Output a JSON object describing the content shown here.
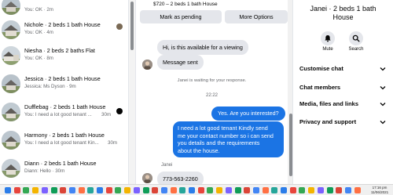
{
  "conversations": [
    {
      "name": "",
      "preview": "You: OK · 2m",
      "meta": "",
      "indicator": "none"
    },
    {
      "name": "Nichole · 2 beds 1 bath House",
      "preview": "You: OK · 4m",
      "meta": "",
      "indicator": "avatar"
    },
    {
      "name": "Niesha · 2 beds 2 baths Flat",
      "preview": "You: OK · 8m",
      "meta": "",
      "indicator": "none"
    },
    {
      "name": "Jessica · 2 beds 1 bath House",
      "preview": "Jessica: Ms Dyson · 9m",
      "meta": "",
      "indicator": "none"
    },
    {
      "name": "Dufflebag · 2 beds 1 bath House",
      "preview": "You: I need a lot good tenant ...",
      "meta": "30m",
      "indicator": "dot"
    },
    {
      "name": "Harmony · 2 beds 1 bath House",
      "preview": "You: I need a lot good tenant Kin...",
      "meta": "30m",
      "indicator": "none"
    },
    {
      "name": "Diann · 2 beds 1 bath House",
      "preview": "Diann: Hello · 30m",
      "meta": "",
      "indicator": "none"
    }
  ],
  "chat": {
    "listing": "$720 – 2 beds 1 bath House",
    "mark_pending_label": "Mark as pending",
    "more_options_label": "More Options",
    "messages_in": [
      "Hi, is this available for a viewing",
      "Message sent"
    ],
    "system_note": "Janei is waiting for your response.",
    "time_divider": "22:22",
    "out_short": "Yes. Are you interested?",
    "out_long": [
      "I need a lot good tenant Kindly send",
      "me your contact number so i can send",
      "you details and the requirements",
      "about the house."
    ],
    "last_sender": "Janei",
    "last_message": "773-563-2260"
  },
  "info": {
    "title_line1": "Janei · 2 beds 1 bath",
    "title_line2": "House",
    "mute_label": "Mute",
    "search_label": "Search",
    "sections": [
      "Customise chat",
      "Chat members",
      "Media, files and links",
      "Privacy and support"
    ]
  },
  "taskbar": {
    "time": "17:16 pm",
    "date": "11/06/2021"
  },
  "colors": {
    "accent": "#1b74e4",
    "bubble_in": "#e4e6eb",
    "secondary_text": "#65676b"
  }
}
